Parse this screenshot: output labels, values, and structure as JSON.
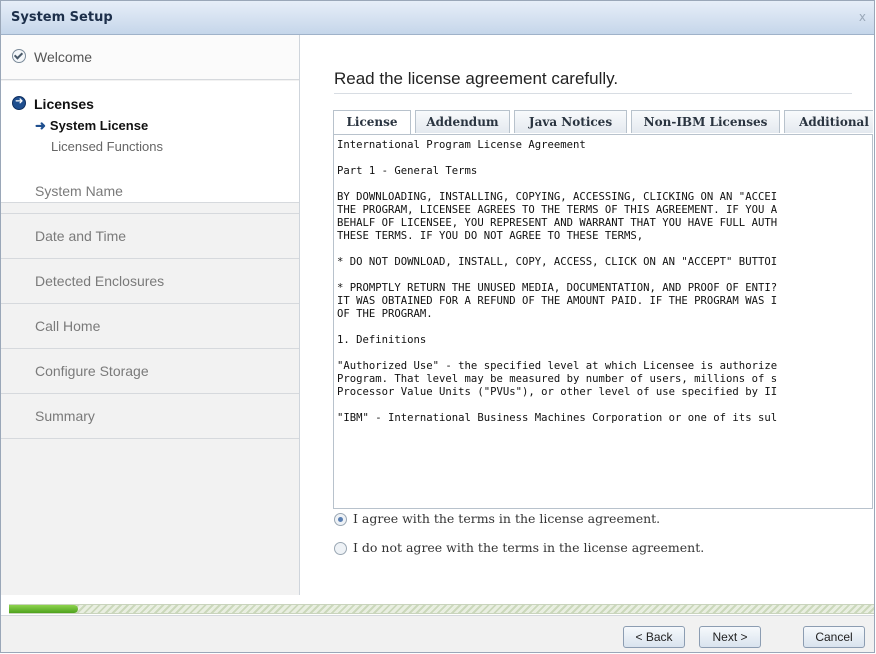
{
  "window": {
    "title": "System Setup",
    "close_glyph": "x"
  },
  "sidebar": {
    "completed": {
      "label": "Welcome",
      "icon": "check-circle-icon"
    },
    "active": {
      "label": "Licenses",
      "icon": "arrow-circle-icon",
      "sub_items": [
        {
          "label": "System License",
          "current": true
        },
        {
          "label": "Licensed Functions",
          "current": false
        }
      ]
    },
    "steps": [
      "System Name",
      "Date and Time",
      "Detected Enclosures",
      "Call Home",
      "Configure Storage",
      "Summary"
    ]
  },
  "main": {
    "heading": "Read the license agreement carefully.",
    "tabs": [
      "License",
      "Addendum",
      "Java Notices",
      "Non-IBM Licenses",
      "Additional"
    ],
    "active_tab": "License",
    "license_lines": [
      "International Program License Agreement",
      "",
      "Part 1 - General Terms",
      "",
      "BY DOWNLOADING, INSTALLING, COPYING, ACCESSING, CLICKING ON AN \"ACCEI",
      "THE PROGRAM, LICENSEE AGREES TO THE TERMS OF THIS AGREEMENT. IF YOU A",
      "BEHALF OF LICENSEE, YOU REPRESENT AND WARRANT THAT YOU HAVE FULL AUTH",
      "THESE TERMS. IF YOU DO NOT AGREE TO THESE TERMS,",
      "",
      "* DO NOT DOWNLOAD, INSTALL, COPY, ACCESS, CLICK ON AN \"ACCEPT\" BUTTOI",
      "",
      "* PROMPTLY RETURN THE UNUSED MEDIA, DOCUMENTATION, AND PROOF OF ENTI?",
      "IT WAS OBTAINED FOR A REFUND OF THE AMOUNT PAID. IF THE PROGRAM WAS I",
      "OF THE PROGRAM.",
      "",
      "1. Definitions",
      "",
      "\"Authorized Use\" - the specified level at which Licensee is authorize",
      "Program. That level may be measured by number of users, millions of s",
      "Processor Value Units (\"PVUs\"), or other level of use specified by II",
      "",
      "\"IBM\" - International Business Machines Corporation or one of its sul"
    ],
    "options": [
      {
        "label": "I agree with the terms in the license agreement.",
        "selected": true
      },
      {
        "label": "I do not agree with the terms in the license agreement.",
        "selected": false
      }
    ]
  },
  "progress": {
    "fraction": 0.08,
    "color": "#6dbb32"
  },
  "footer": {
    "back_label": "< Back",
    "next_label": "Next >",
    "cancel_label": "Cancel"
  }
}
